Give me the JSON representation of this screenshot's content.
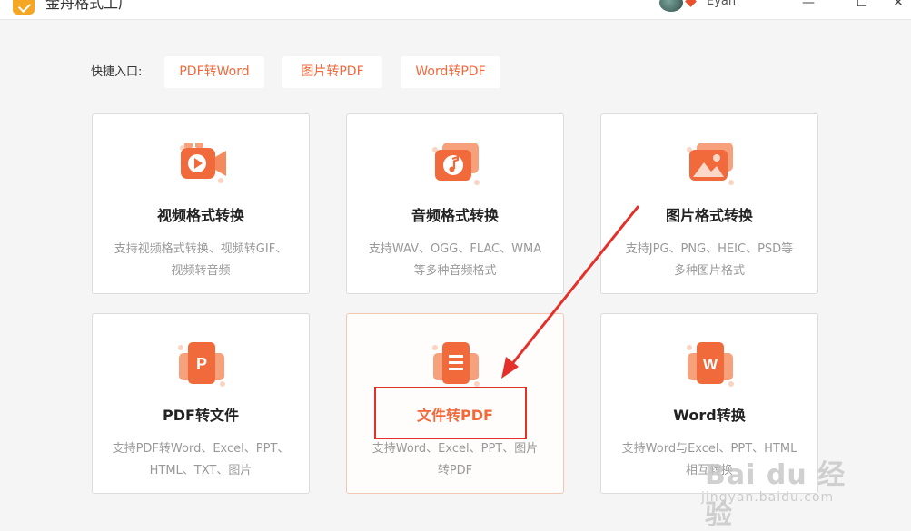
{
  "titlebar": {
    "app_title": "金舟格式工厂",
    "user_name": "Eyan",
    "minimize": "—",
    "maximize": "☐",
    "close": "✕"
  },
  "quick": {
    "label": "快捷入口:",
    "buttons": [
      "PDF转Word",
      "图片转PDF",
      "Word转PDF"
    ]
  },
  "cards": [
    {
      "title": "视频格式转换",
      "desc_line1": "支持视频格式转换、视频转GIF、",
      "desc_line2": "视频转音频",
      "icon": "video-camera-icon"
    },
    {
      "title": "音频格式转换",
      "desc_line1": "支持WAV、OGG、FLAC、WMA",
      "desc_line2": "等多种音频格式",
      "icon": "music-note-icon"
    },
    {
      "title": "图片格式转换",
      "desc_line1": "支持JPG、PNG、HEIC、PSD等",
      "desc_line2": "多种图片格式",
      "icon": "picture-icon"
    },
    {
      "title": "PDF转文件",
      "desc_line1": "支持PDF转Word、Excel、PPT、",
      "desc_line2": "HTML、TXT、图片",
      "icon": "pdf-file-icon"
    },
    {
      "title": "文件转PDF",
      "desc_line1": "支持Word、Excel、PPT、图片",
      "desc_line2": "转PDF",
      "icon": "document-icon"
    },
    {
      "title": "Word转换",
      "desc_line1": "支持Word与Excel、PPT、HTML",
      "desc_line2": "相互转换",
      "icon": "word-file-icon"
    }
  ],
  "icon_letters": {
    "pdf": "P",
    "word": "W"
  },
  "watermark": {
    "brand": "Bai du 经验",
    "url": "jingyan.baidu.com"
  },
  "colors": {
    "accent": "#f06a3c",
    "annotation_red": "#e3312a"
  }
}
